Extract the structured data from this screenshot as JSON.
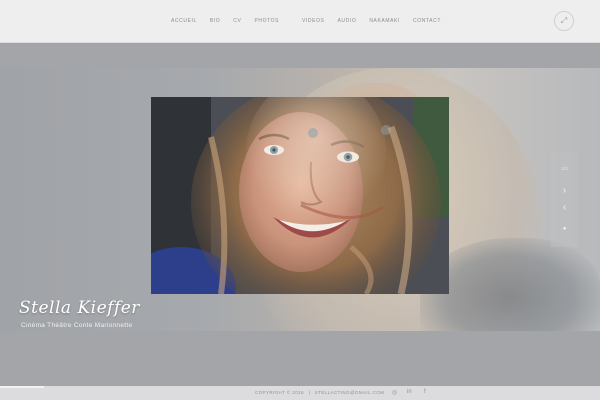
{
  "nav": {
    "left": [
      "ACCUEIL",
      "BIO",
      "CV",
      "PHOTOS"
    ],
    "right": [
      "VIDEOS",
      "AUDIO",
      "NAKAMAKI",
      "CONTACT"
    ]
  },
  "slider": {
    "counter": "1/3",
    "next_icon": "›",
    "prev_icon": "‹",
    "dot_icon": "●"
  },
  "caption": {
    "name": "Stella Kieffer",
    "subtitle": "Cinéma Théâtre Conte Marionnette"
  },
  "footer": {
    "copyright": "COPYRIGHT © 2016",
    "separator": "|",
    "email": "STELLACTING@GMAIL.COM"
  },
  "icons": {
    "fullscreen": "⤢",
    "instagram": "◎",
    "linkedin": "in",
    "facebook": "f"
  },
  "colors": {
    "header": "#eeeeef",
    "background": "#a6a8ab",
    "caption": "#ffffff"
  }
}
